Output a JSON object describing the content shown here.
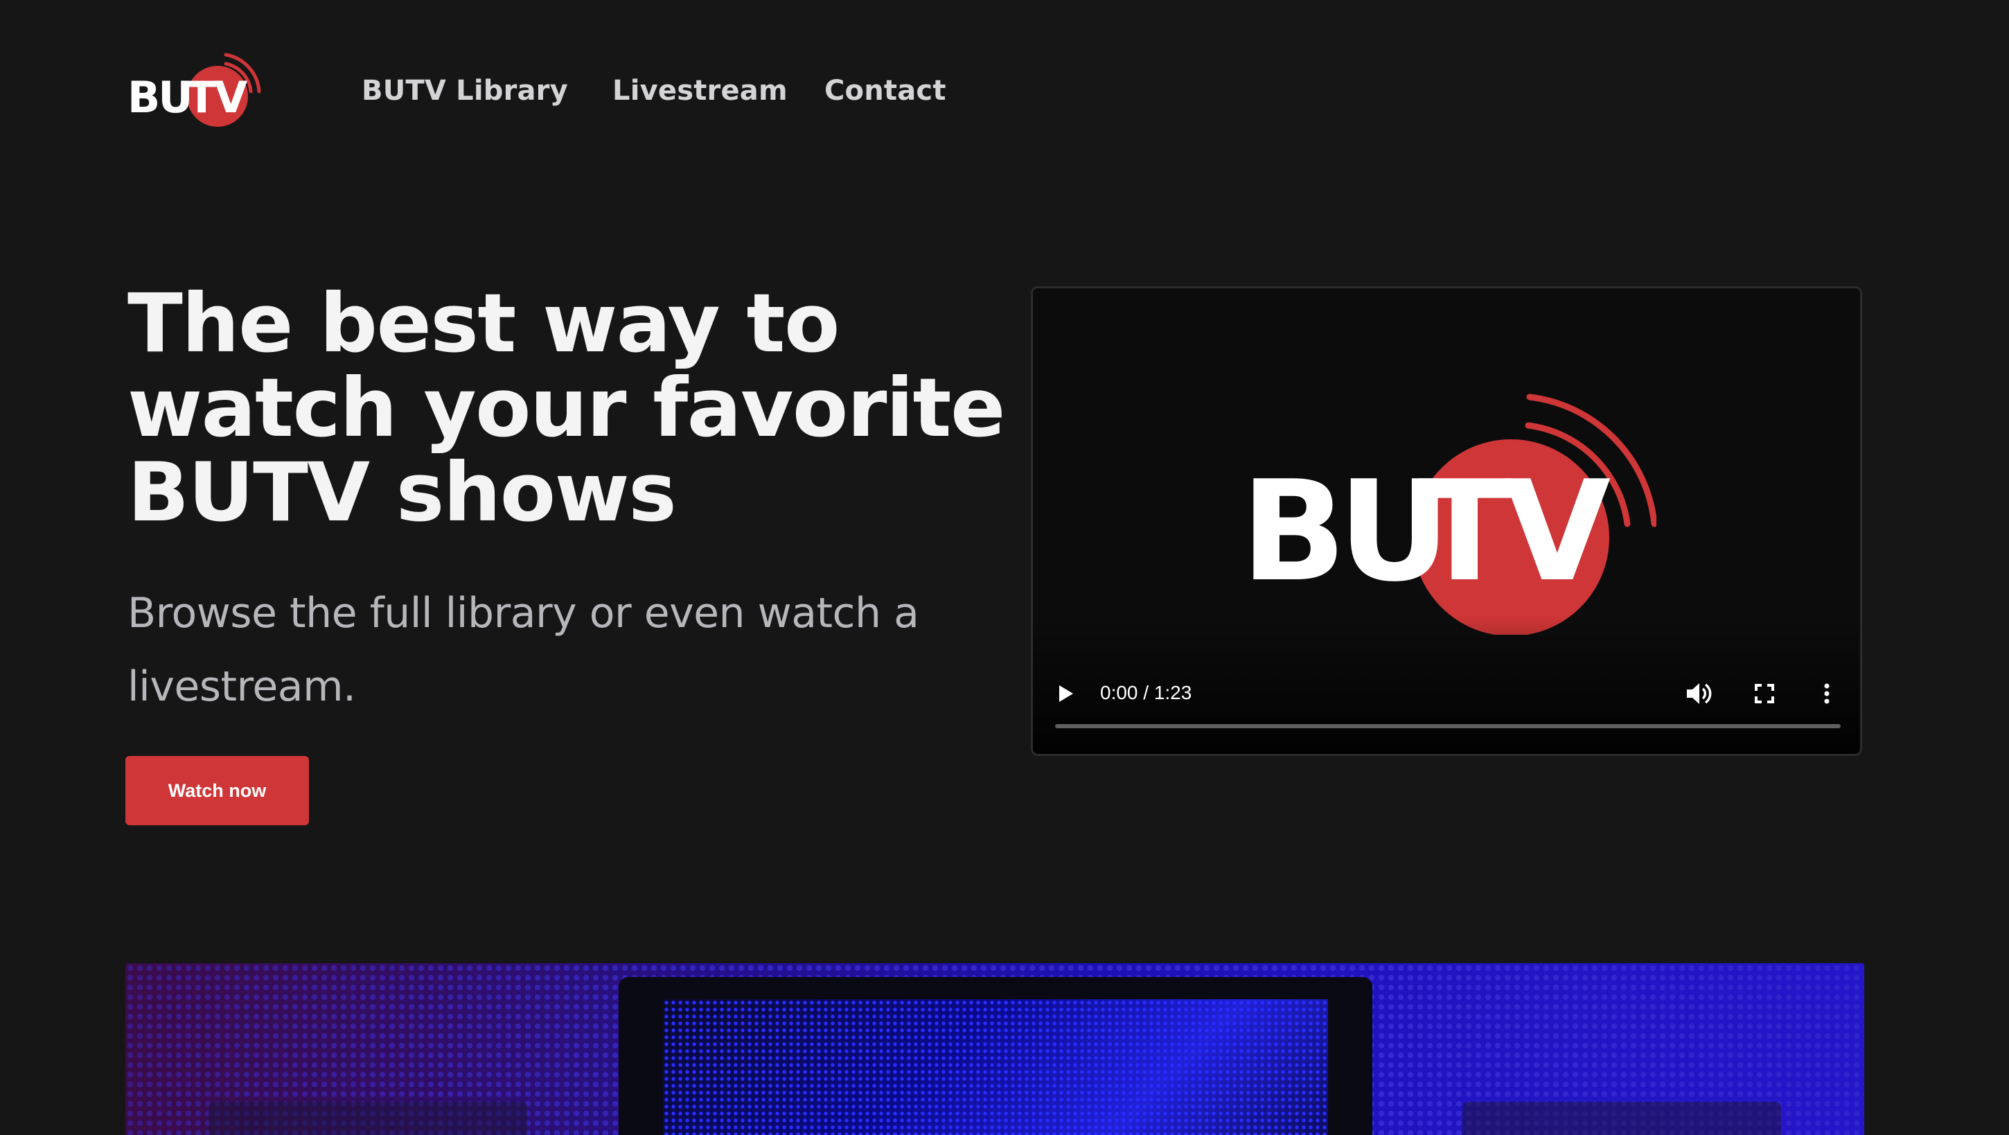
{
  "header": {
    "logo_text": "BUTV",
    "nav": [
      {
        "label": "BUTV Library"
      },
      {
        "label": "Livestream"
      },
      {
        "label": "Contact"
      }
    ]
  },
  "hero": {
    "title_line1": "The best way to",
    "title_line2": "watch your favorite",
    "title_line3": "BUTV shows",
    "subtitle": "Browse the full library or even watch a livestream.",
    "cta_label": "Watch now"
  },
  "player": {
    "logo_text": "BUTV",
    "time": "0:00 / 1:23",
    "progress": 0
  },
  "colors": {
    "background": "#161617",
    "brand_red": "#cf3637",
    "text_primary": "#f4f4f4",
    "text_secondary": "#b7b7bb"
  },
  "icons": {
    "play": "play-icon",
    "volume": "volume-icon",
    "fullscreen": "fullscreen-icon",
    "more": "more-vertical-icon"
  }
}
